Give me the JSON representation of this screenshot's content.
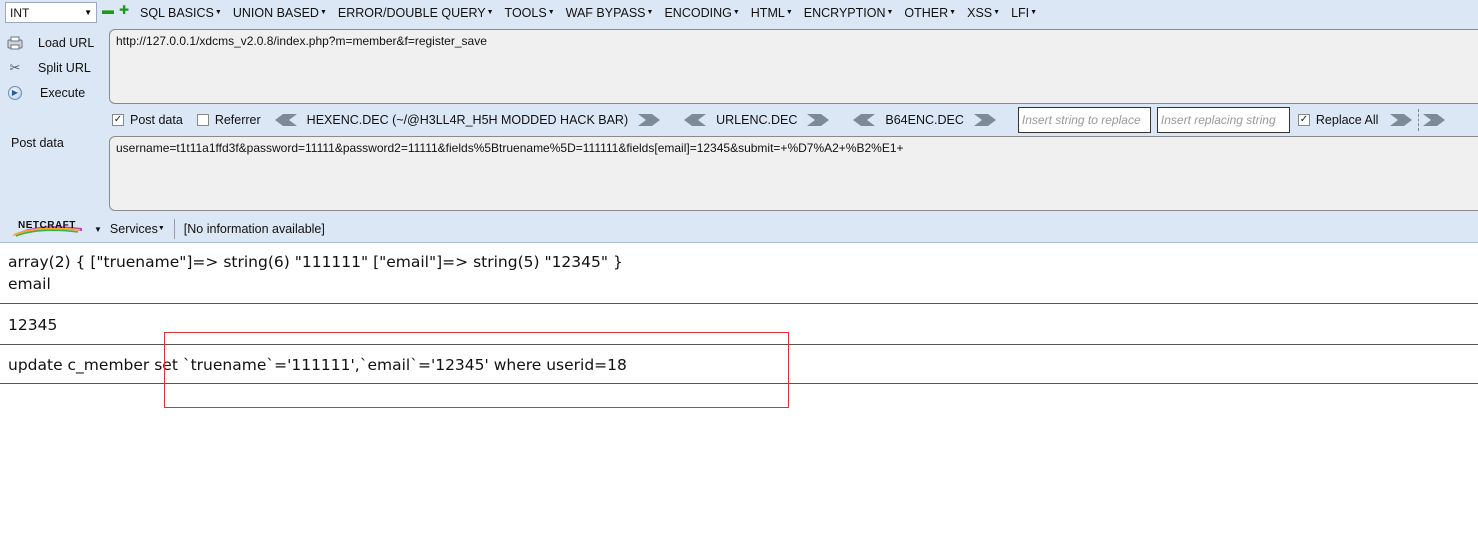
{
  "toolbar": {
    "type_select": "INT",
    "menus": [
      {
        "label": "SQL BASICS"
      },
      {
        "label": "UNION BASED"
      },
      {
        "label": "ERROR/DOUBLE QUERY"
      },
      {
        "label": "TOOLS"
      },
      {
        "label": "WAF BYPASS"
      },
      {
        "label": "ENCODING"
      },
      {
        "label": "HTML"
      },
      {
        "label": "ENCRYPTION"
      },
      {
        "label": "OTHER"
      },
      {
        "label": "XSS"
      },
      {
        "label": "LFI"
      }
    ]
  },
  "actions": {
    "load_url": "Load URL",
    "split_url": "Split URL",
    "execute": "Execute"
  },
  "url": "http://127.0.0.1/xdcms_v2.0.8/index.php?m=member&f=register_save",
  "options": {
    "post_data_label": "Post data",
    "post_data_checked": true,
    "referrer_label": "Referrer",
    "referrer_checked": false,
    "hexenc": "HEXENC.DEC (~/@H3LL4R_H5H MODDED HACK BAR)",
    "urlenc": "URLENC.DEC",
    "b64enc": "B64ENC.DEC",
    "replace_string_placeholder": "Insert string to replace",
    "replacing_string_placeholder": "Insert replacing string",
    "replace_all_label": "Replace All",
    "replace_all_checked": true
  },
  "post": {
    "label": "Post data",
    "value": "username=t1t11a1ffd3f&password=11111&password2=11111&fields%5Btruename%5D=111111&fields[email]=12345&submit=+%D7%A2+%B2%E1+"
  },
  "netcraft": {
    "logo": "NETCRAFT",
    "services": "Services",
    "info": "[No information available]"
  },
  "page": {
    "line1": "array(2) { [\"truename\"]=> string(6) \"111111\" [\"email\"]=> string(5) \"12345\" }",
    "line2": "email",
    "line3": "12345",
    "line4": "update c_member set `truename`='111111',`email`='12345' where userid=18"
  },
  "colors": {
    "toolbar_bg": "#dbe7f5",
    "highlight_border": "#e0302f"
  }
}
